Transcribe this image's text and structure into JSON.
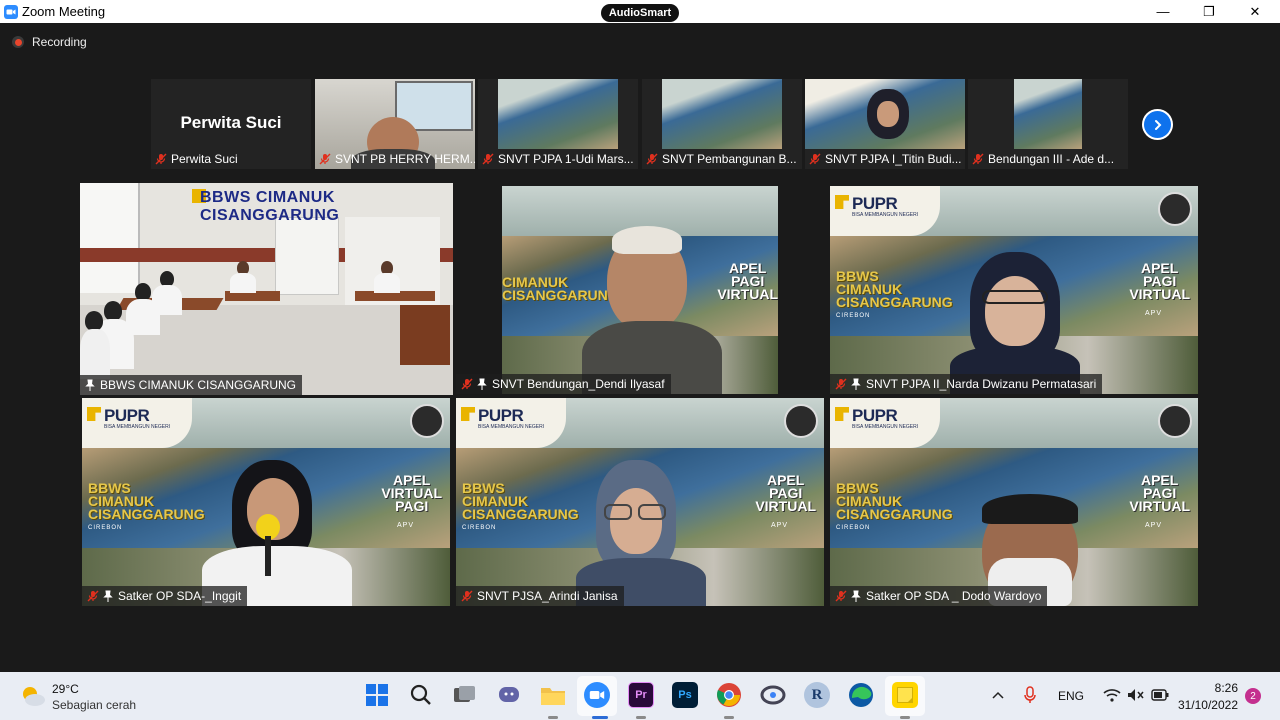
{
  "window": {
    "title": "Zoom Meeting",
    "center_badge": "AudioSmart",
    "minimize_glyph": "—",
    "maximize_glyph": "❐",
    "close_glyph": "✕"
  },
  "recording": {
    "label": "Recording"
  },
  "strip": [
    {
      "name": "Perwita Suci",
      "big_name": "Perwita Suci"
    },
    {
      "name": "SVNT PB HERRY HERM..."
    },
    {
      "name": "SNVT PJPA 1-Udi Mars..."
    },
    {
      "name": "SNVT Pembangunan B..."
    },
    {
      "name": "SNVT PJPA I_Titin Budi..."
    },
    {
      "name": "Bendungan III - Ade d..."
    }
  ],
  "tiles": [
    {
      "name": "BBWS CIMANUK CISANGGARUNG",
      "banner": "BBWS CIMANUK CISANGGARUNG"
    },
    {
      "name": "SNVT Bendungan_Dendi Ilyasaf"
    },
    {
      "name": "SNVT PJPA II_Narda Dwizanu Permatasari"
    },
    {
      "name": "Satker OP SDA-_Inggit"
    },
    {
      "name": "SNVT PJSA_Arindi Janisa"
    },
    {
      "name": "Satker OP SDA _ Dodo Wardoyo"
    }
  ],
  "background": {
    "pupr": "PUPR",
    "pupr_sub": "BISA MEMBANGUN NEGERI",
    "bbws_line1": "BBWS",
    "bbws_line2": "CIMANUK",
    "bbws_line3": "CISANGGARUNG",
    "cirebon": "CIREBON",
    "apv_line1": "APEL",
    "apv_line2": "PAGI",
    "apv_line3": "VIRTUAL",
    "apv_small": "APV"
  },
  "taskbar": {
    "temperature": "29°C",
    "weather": "Sebagian cerah",
    "language": "ENG",
    "time": "8:26",
    "date": "31/10/2022",
    "notification_count": "2",
    "apps": [
      "Start",
      "Search",
      "Task View",
      "Teams Chat",
      "File Explorer",
      "Zoom",
      "Premiere Pro",
      "Photoshop",
      "Chrome",
      "Rambox",
      "R",
      "Edge",
      "Sticky Notes"
    ]
  },
  "colors": {
    "active_speaker": "#a9d33e",
    "zoom_blue": "#2d8cff",
    "mute_red": "#e0301e"
  }
}
